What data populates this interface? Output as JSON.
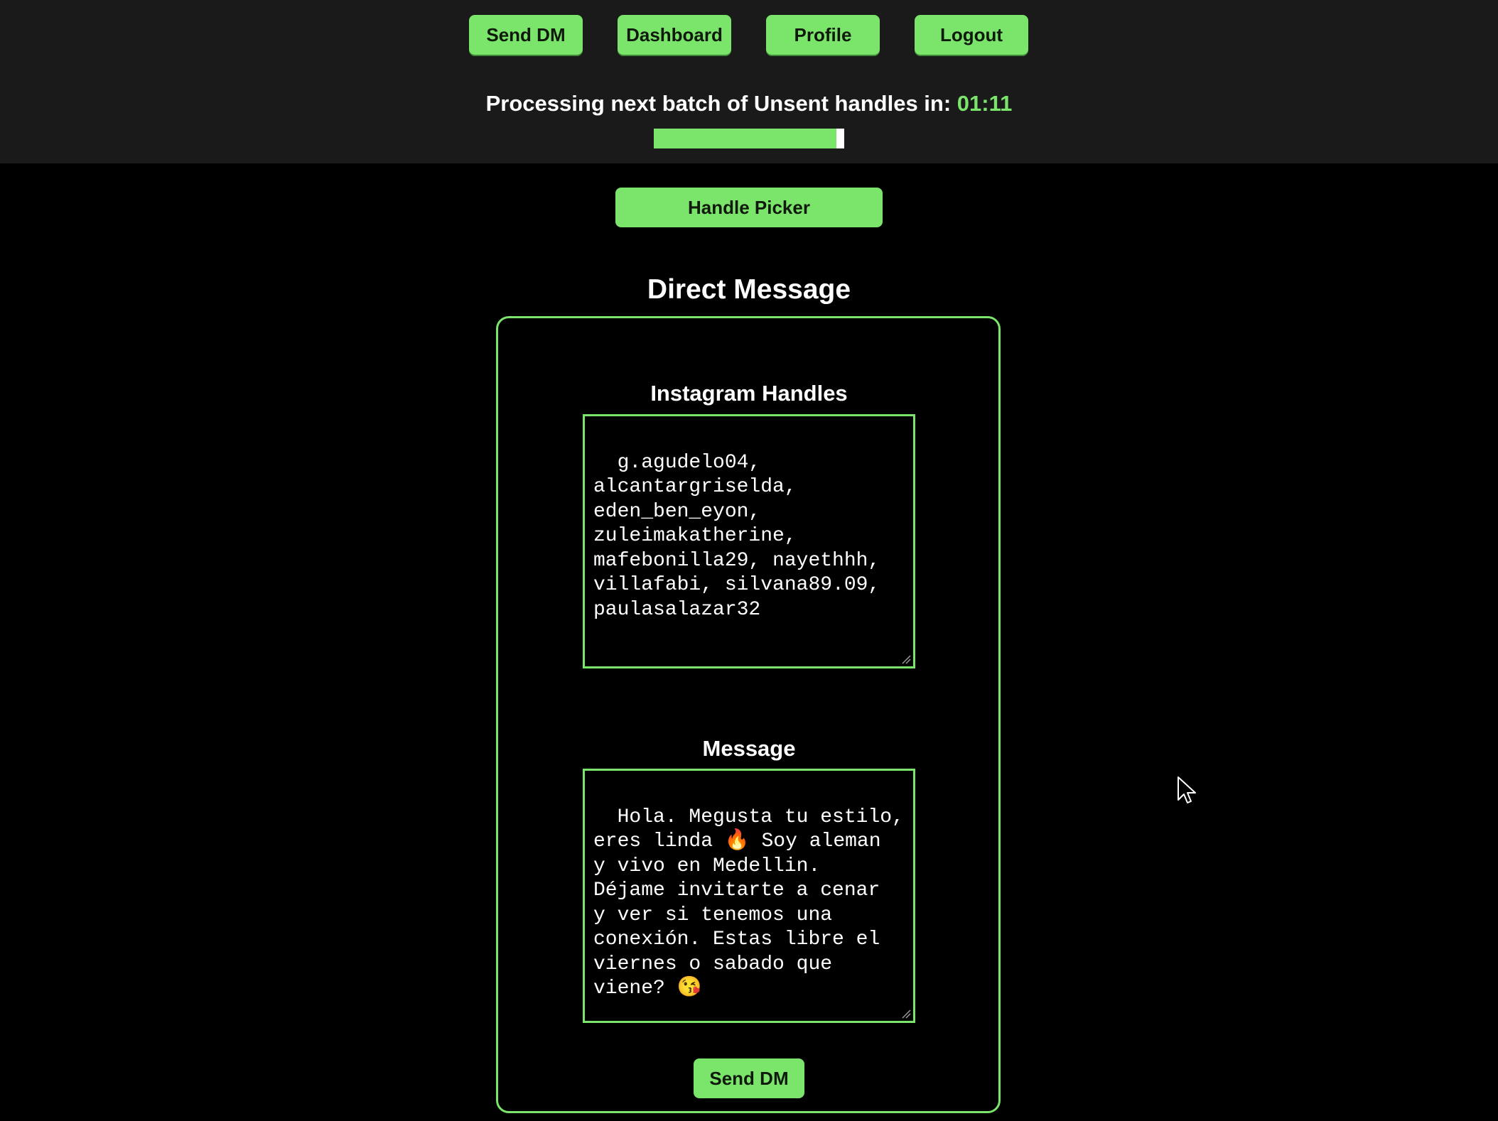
{
  "nav": {
    "items": [
      {
        "label": "Send DM"
      },
      {
        "label": "Dashboard"
      },
      {
        "label": "Profile"
      },
      {
        "label": "Logout"
      }
    ]
  },
  "status": {
    "prefix": "Processing next batch of Unsent handles in: ",
    "timer": "01:11",
    "progress_fraction": 0.96
  },
  "handle_picker": {
    "label": "Handle Picker"
  },
  "direct_message": {
    "title": "Direct Message",
    "handles_label": "Instagram Handles",
    "handles_value": "g.agudelo04,\nalcantargriselda,\neden_ben_eyon,\nzuleimakatherine,\nmafebonilla29, nayethhh,\nvillafabi, silvana89.09,\npaulasalazar32",
    "message_label": "Message",
    "message_value": "Hola. Megusta tu estilo,\neres linda 🔥 Soy aleman\ny vivo en Medellin.\nDéjame invitarte a cenar\ny ver si tenemos una\nconexión. Estas libre el\nviernes o sabado que\nviene? 😘",
    "send_label": "Send DM"
  },
  "colors": {
    "accent": "#7be46b",
    "topbar_bg": "#1a1a1a",
    "page_bg": "#000000"
  },
  "icons": {
    "cursor": "mouse-pointer-icon",
    "resize": "resize-grip-icon"
  }
}
